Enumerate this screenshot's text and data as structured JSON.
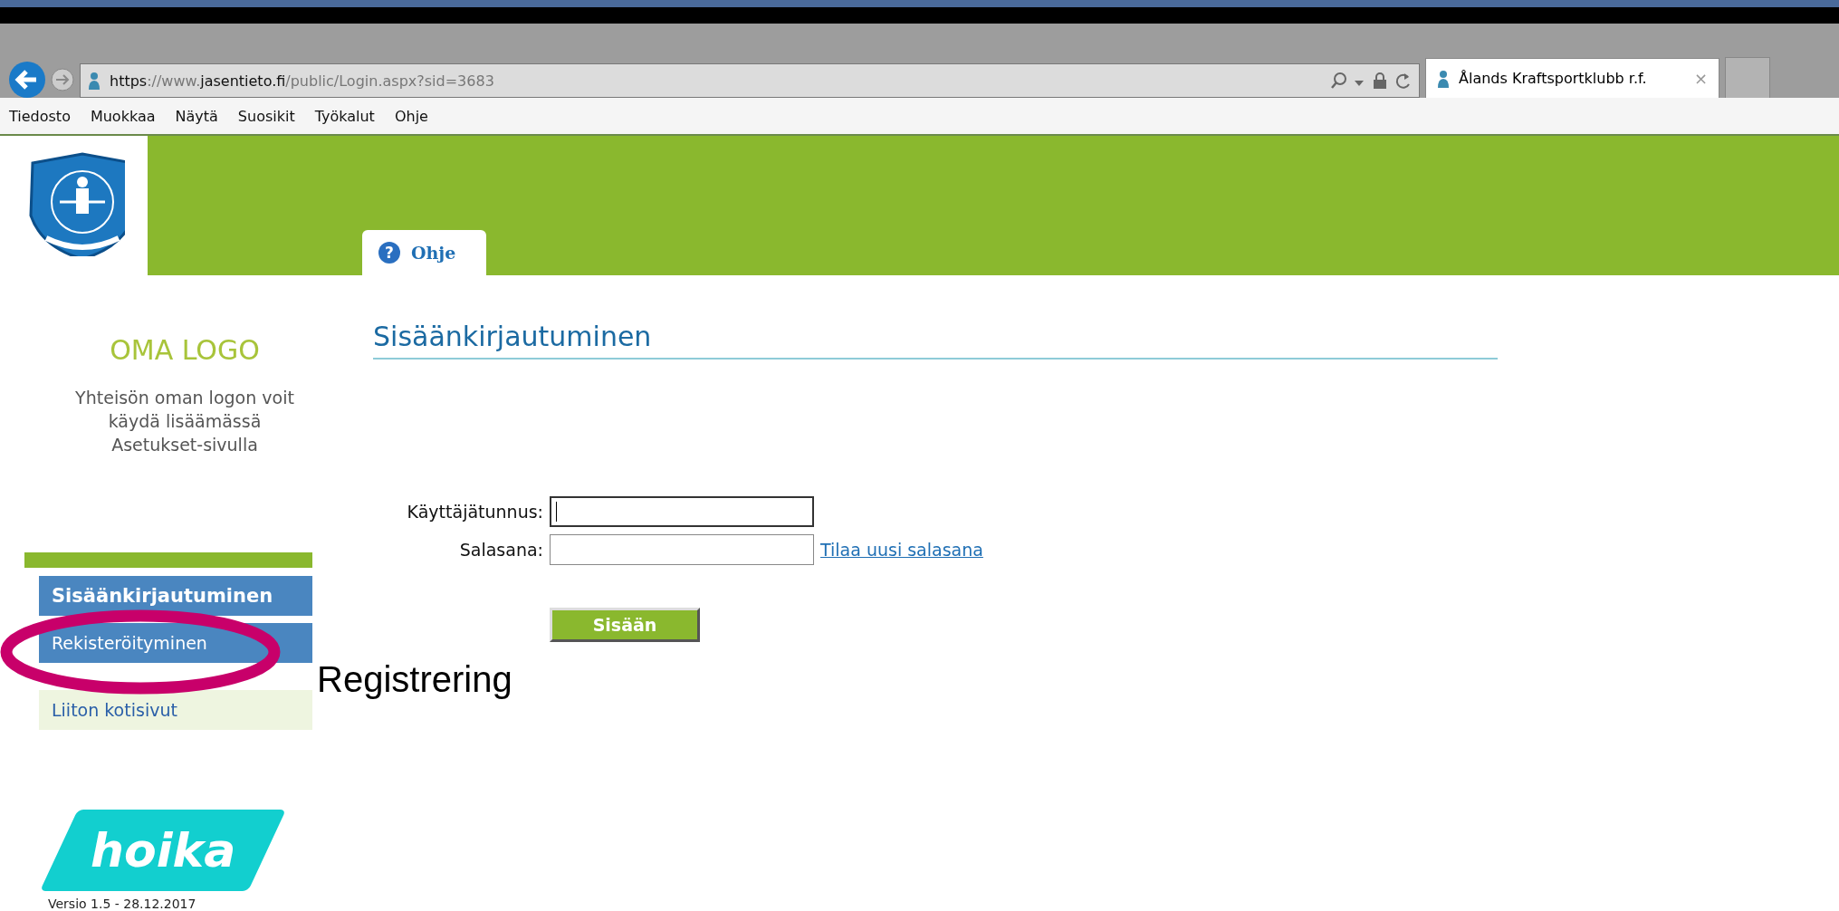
{
  "browser": {
    "address": {
      "scheme": "https",
      "prefix": "://www.",
      "domain": "jasentieto.fi",
      "path": "/public/Login.aspx?sid=3683"
    },
    "tab": {
      "title": "Ålands Kraftsportklubb r.f.",
      "close": "×"
    },
    "menu": [
      "Tiedosto",
      "Muokkaa",
      "Näytä",
      "Suosikit",
      "Työkalut",
      "Ohje"
    ]
  },
  "header": {
    "tabs": [
      {
        "label": "Ohje",
        "icon_glyph": "?",
        "selected": true
      }
    ]
  },
  "sidebar": {
    "logo_title": "OMA LOGO",
    "logo_text": "Yhteisön oman logon voit käydä lisäämässä Asetukset-sivulla",
    "items": [
      {
        "label": "Sisäänkirjautuminen",
        "kind": "bold"
      },
      {
        "label": "Rekisteröityminen",
        "kind": "normal"
      },
      {
        "label": "Liiton kotisivut",
        "kind": "external"
      }
    ],
    "brand": "hoika",
    "version": "Versio 1.5 - 28.12.2017"
  },
  "page": {
    "title": "Sisäänkirjautuminen",
    "fields": [
      {
        "label": "Käyttäjätunnus:",
        "focused": true
      },
      {
        "label": "Salasana:",
        "focused": false,
        "link": "Tilaa uusi salasana"
      }
    ],
    "button": "Sisään"
  },
  "annotation": {
    "text": "Registrering"
  }
}
